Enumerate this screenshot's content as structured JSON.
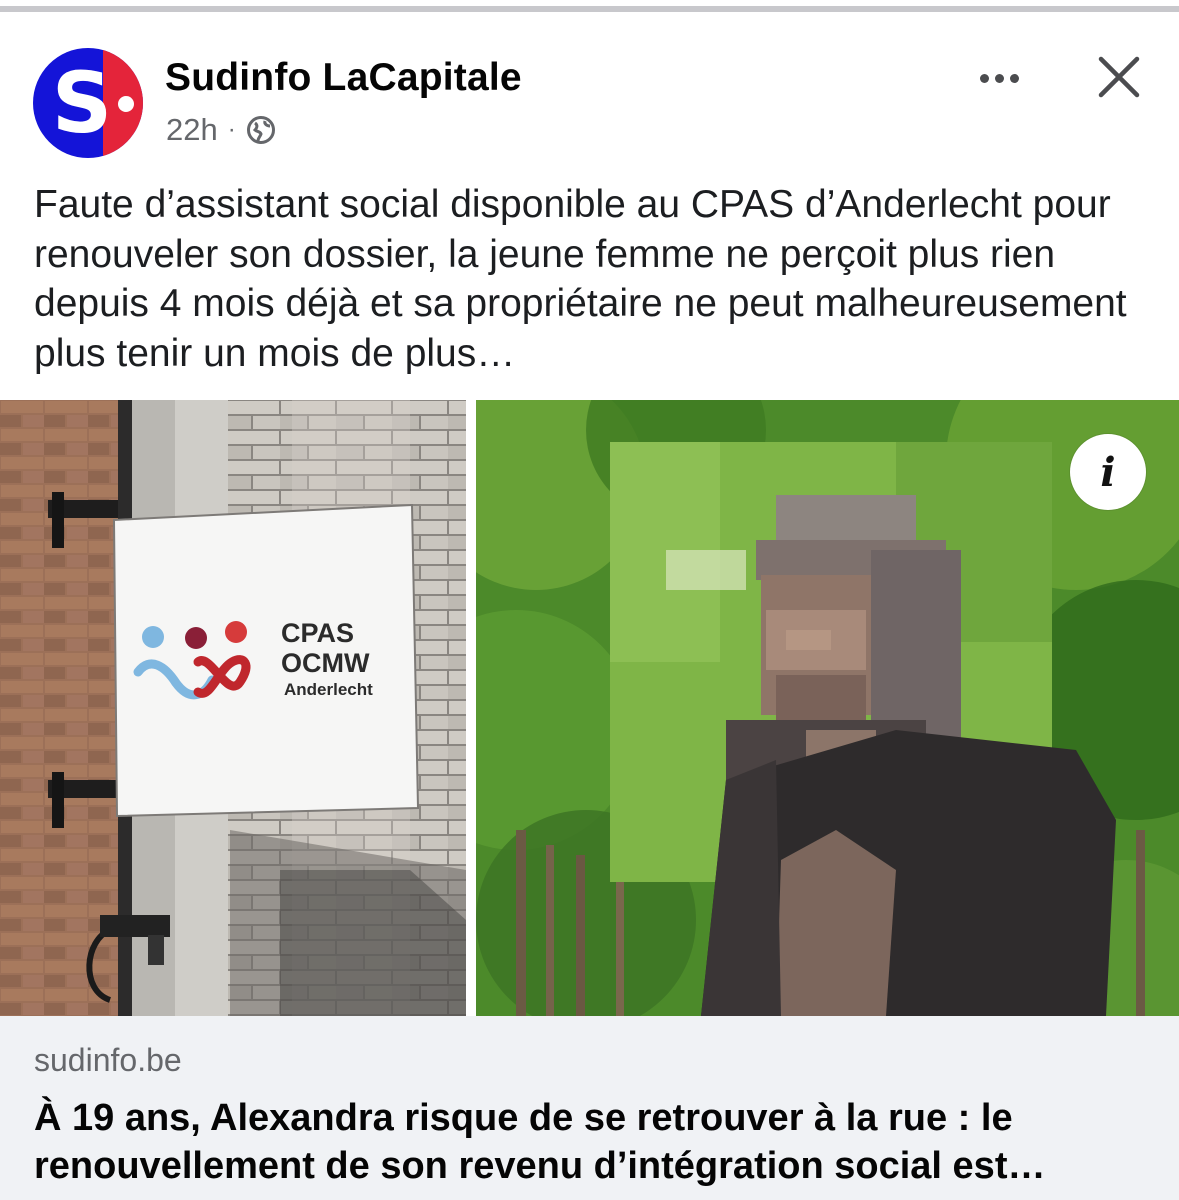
{
  "post": {
    "page_name": "Sudinfo LaCapitale",
    "time": "22h",
    "separator": "·",
    "privacy_icon": "globe-icon",
    "avatar_letter": "S",
    "caption": "Faute d’assistant social disponible au CPAS d’Anderlecht pour renouveler son dossier, la jeune femme ne perçoit plus rien depuis 4 mois déjà et sa propriétaire ne peut malheureusement plus tenir un mois de plus…"
  },
  "sign": {
    "line1": "CPAS",
    "line2": "OCMW",
    "line3": "Anderlecht"
  },
  "info_icon_label": "i",
  "link": {
    "domain": "sudinfo.be",
    "headline": "À 19 ans, Alexandra risque de se retrouver à la rue : le renouvellement de son revenu d’intégration social est…"
  },
  "colors": {
    "brand_blue": "#1414d8",
    "brand_red": "#e4243a",
    "link_bg": "#f0f2f5",
    "muted_text": "#65676b"
  }
}
